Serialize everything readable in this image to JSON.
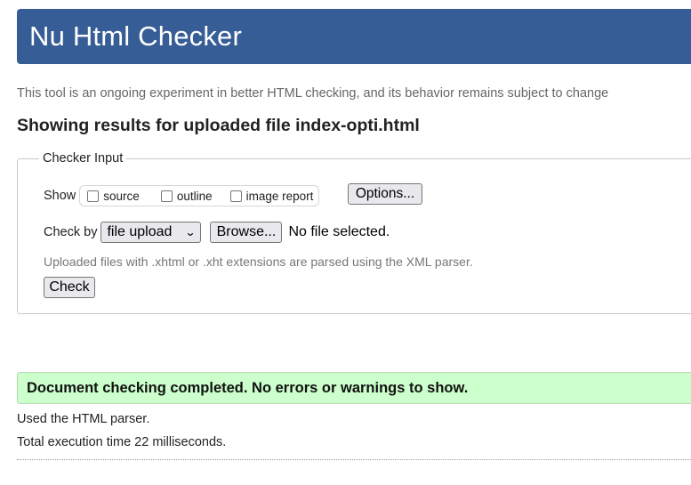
{
  "header": {
    "title": "Nu Html Checker"
  },
  "intro": "This tool is an ongoing experiment in better HTML checking, and its behavior remains subject to change",
  "results_title": "Showing results for uploaded file index-opti.html",
  "checker_input": {
    "legend": "Checker Input",
    "show_label": "Show",
    "show_options": [
      {
        "label": "source",
        "checked": false
      },
      {
        "label": "outline",
        "checked": false
      },
      {
        "label": "image report",
        "checked": false
      }
    ],
    "options_button": "Options...",
    "check_by_label": "Check by",
    "check_by_value": "file upload",
    "browse_button": "Browse...",
    "file_status": "No file selected.",
    "hint": "Uploaded files with .xhtml or .xht extensions are parsed using the XML parser.",
    "check_button": "Check"
  },
  "result": {
    "message": "Document checking completed. No errors or warnings to show.",
    "parser_note": "Used the HTML parser.",
    "execution_time": "Total execution time 22 milliseconds.",
    "success_color": "#ccffcc"
  },
  "colors": {
    "header_bg": "#365d95",
    "header_text": "#ffffff"
  }
}
